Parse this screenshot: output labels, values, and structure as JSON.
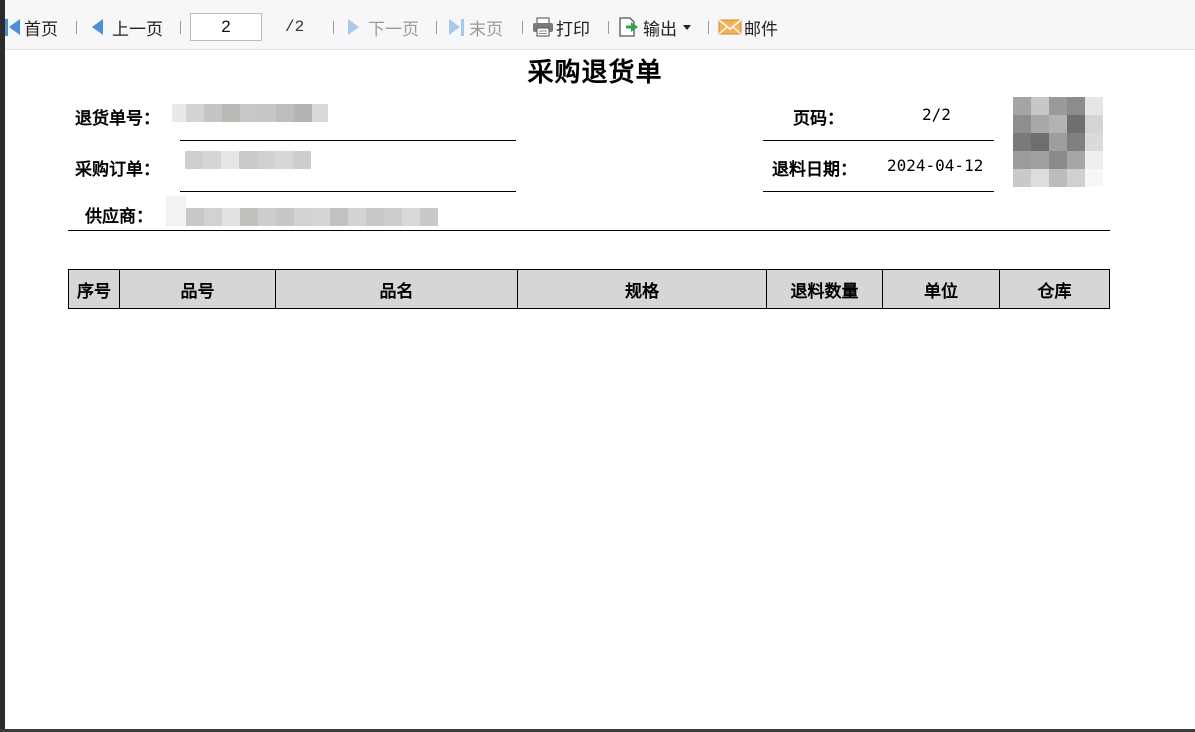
{
  "toolbar": {
    "first_page_label": "首页",
    "prev_page_label": "上一页",
    "current_page": "2",
    "total_pages": "/2",
    "next_page_label": "下一页",
    "last_page_label": "末页",
    "print_label": "打印",
    "export_label": "输出",
    "mail_label": "邮件"
  },
  "report": {
    "title": "采购退货单",
    "return_no_label": "退货单号：",
    "purchase_order_label": "采购订单：",
    "supplier_label": "供应商：",
    "page_no_label": "页码：",
    "page_no_value": "2/2",
    "return_date_label": "退料日期：",
    "return_date_value": "2024-04-12"
  },
  "table": {
    "headers": [
      "序号",
      "品号",
      "品名",
      "规格",
      "退料数量",
      "单位",
      "仓库"
    ]
  },
  "colors": {
    "accent": "#4b8fd6",
    "header_fill": "#d6d6d6",
    "toolbar_bg": "#f7f7f9"
  }
}
